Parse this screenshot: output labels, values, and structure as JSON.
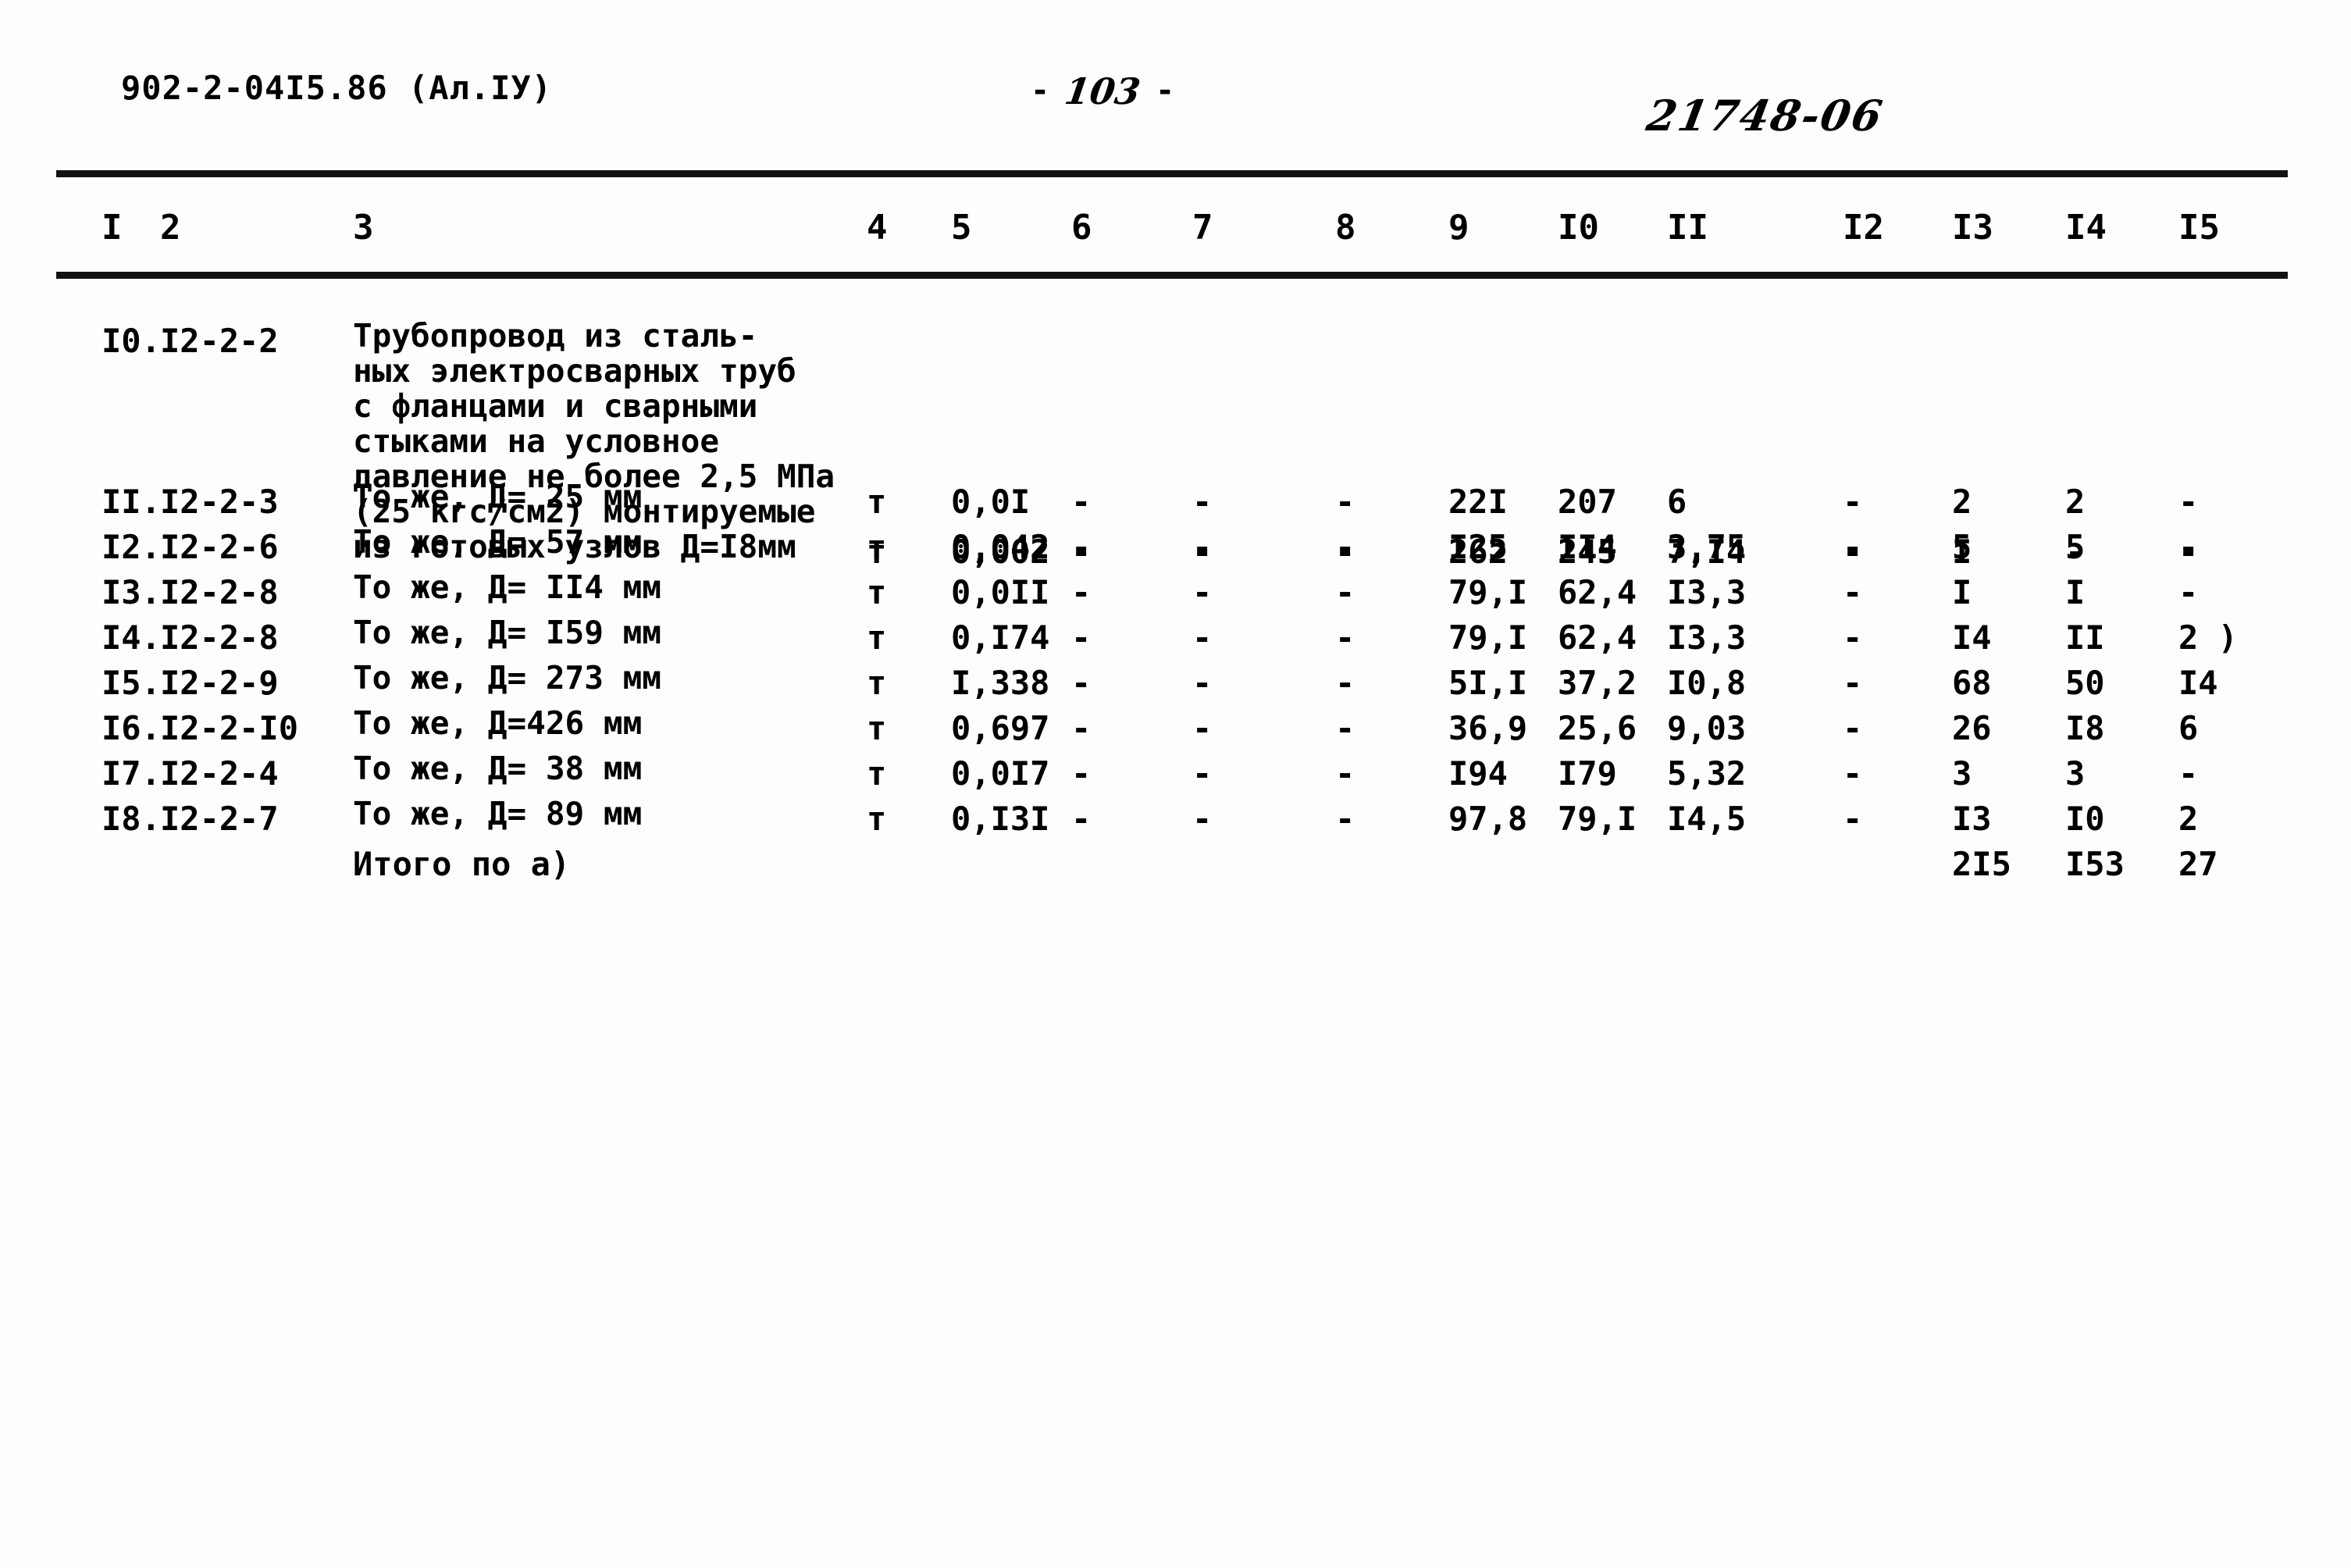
{
  "header": {
    "doc_code": "902-2-04I5.86 (Ал.IУ)",
    "page_marker_left": "-",
    "page_number": "103",
    "page_marker_right": "-",
    "stamp_number": "21748-06"
  },
  "table": {
    "column_headers": [
      "I",
      "2",
      "3",
      "4",
      "5",
      "6",
      "7",
      "8",
      "9",
      "I0",
      "II",
      "I2",
      "I3",
      "I4",
      "I5"
    ],
    "rows": [
      {
        "no": "I0.",
        "code": "I2-2-2",
        "description_lines": [
          "Трубопровод из сталь-",
          "ных электросварных труб",
          "с фланцами и сварными",
          "стыками на условное",
          "давление не более 2,5 МПа",
          "(25 кгс/см2) монтируемые",
          "из готовых узлов Д=I8мм"
        ],
        "unit": "т",
        "c5": "0,002",
        "c6": "-",
        "c7": "-",
        "c8": "-",
        "c9": "262",
        "c10": "245",
        "c11": "7,I4",
        "c12": "-",
        "c13": "I",
        "c14": "-",
        "c15": "-"
      },
      {
        "no": "II.",
        "code": "I2-2-3",
        "description_lines": [
          "То же, Д= 25 мм"
        ],
        "unit": "т",
        "c5": "0,0I",
        "c6": "-",
        "c7": "-",
        "c8": "-",
        "c9": "22I",
        "c10": "207",
        "c11": "6",
        "c12": "-",
        "c13": "2",
        "c14": "2",
        "c15": "-"
      },
      {
        "no": "I2.",
        "code": "I2-2-6",
        "description_lines": [
          "То же, Д= 57 мм"
        ],
        "unit": "т",
        "c5": "0,042",
        "c6": "-",
        "c7": "-",
        "c8": "-",
        "c9": "I25",
        "c10": "II4",
        "c11": "3,75",
        "c12": "-",
        "c13": "5",
        "c14": "5",
        "c15": "-"
      },
      {
        "no": "I3.",
        "code": "I2-2-8",
        "description_lines": [
          "То же, Д= II4 мм"
        ],
        "unit": "т",
        "c5": "0,0II",
        "c6": "-",
        "c7": "-",
        "c8": "-",
        "c9": "79,I",
        "c10": "62,4",
        "c11": "I3,3",
        "c12": "-",
        "c13": "I",
        "c14": "I",
        "c15": "-"
      },
      {
        "no": "I4.",
        "code": "I2-2-8",
        "description_lines": [
          "То же, Д= I59 мм"
        ],
        "unit": "т",
        "c5": "0,I74",
        "c6": "-",
        "c7": "-",
        "c8": "-",
        "c9": "79,I",
        "c10": "62,4",
        "c11": "I3,3",
        "c12": "-",
        "c13": "I4",
        "c14": "II",
        "c15": "2 )"
      },
      {
        "no": "I5.",
        "code": "I2-2-9",
        "description_lines": [
          "То же, Д= 273 мм"
        ],
        "unit": "т",
        "c5": "I,338",
        "c6": "-",
        "c7": "-",
        "c8": "-",
        "c9": "5I,I",
        "c10": "37,2",
        "c11": "I0,8",
        "c12": "-",
        "c13": "68",
        "c14": "50",
        "c15": "I4"
      },
      {
        "no": "I6.",
        "code": "I2-2-I0",
        "description_lines": [
          "То же, Д=426 мм"
        ],
        "unit": "т",
        "c5": "0,697",
        "c6": "-",
        "c7": "-",
        "c8": "-",
        "c9": "36,9",
        "c10": "25,6",
        "c11": "9,03",
        "c12": "-",
        "c13": "26",
        "c14": "I8",
        "c15": "6"
      },
      {
        "no": "I7.",
        "code": "I2-2-4",
        "description_lines": [
          "То же, Д= 38 мм"
        ],
        "unit": "т",
        "c5": "0,0I7",
        "c6": "-",
        "c7": "-",
        "c8": "-",
        "c9": "I94",
        "c10": "I79",
        "c11": "5,32",
        "c12": "-",
        "c13": "3",
        "c14": "3",
        "c15": "-"
      },
      {
        "no": "I8.",
        "code": "I2-2-7",
        "description_lines": [
          "То же, Д= 89 мм"
        ],
        "unit": "т",
        "c5": "0,I3I",
        "c6": "-",
        "c7": "-",
        "c8": "-",
        "c9": "97,8",
        "c10": "79,I",
        "c11": "I4,5",
        "c12": "-",
        "c13": "I3",
        "c14": "I0",
        "c15": "2"
      }
    ],
    "total_row": {
      "label": "Итого по а)",
      "c13": "2I5",
      "c14": "I53",
      "c15": "27"
    }
  }
}
